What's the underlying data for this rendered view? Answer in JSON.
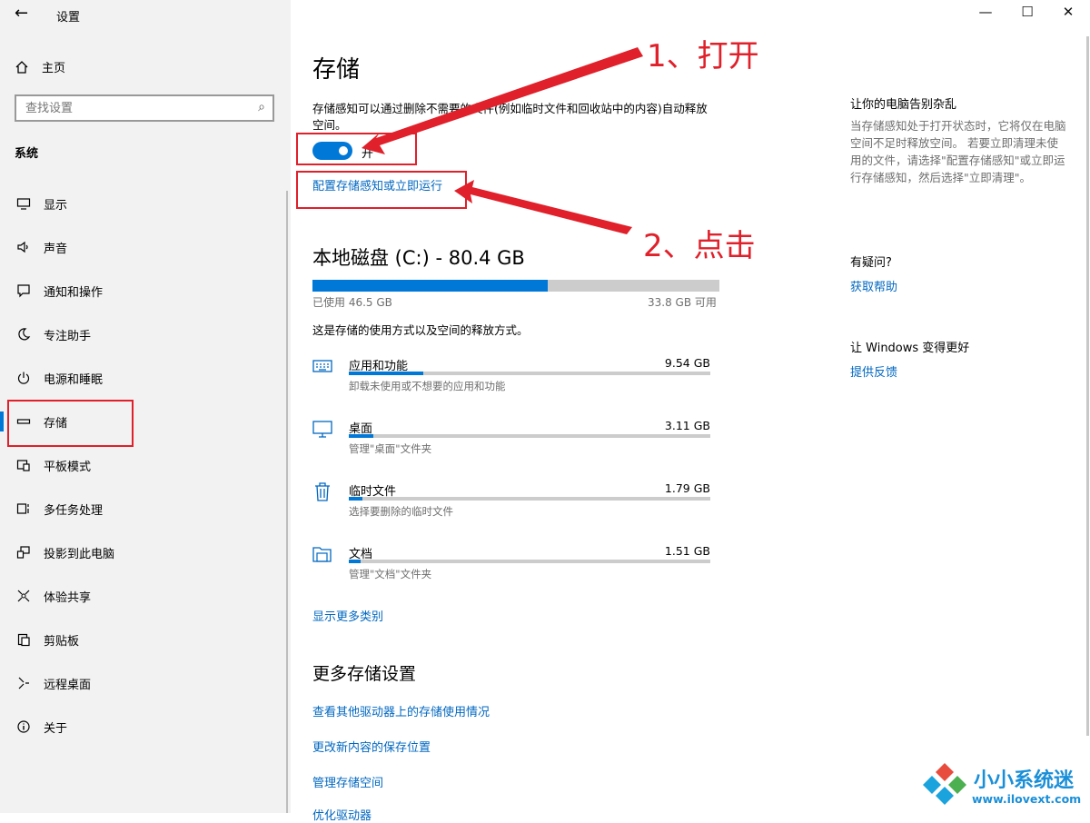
{
  "window": {
    "title": "设置",
    "controls": {
      "minimize": "—",
      "maximize": "☐",
      "close": "✕"
    }
  },
  "sidebar": {
    "home": "主页",
    "search_placeholder": "查找设置",
    "section_label": "系统",
    "items": [
      {
        "label": "显示",
        "icon": "monitor-icon"
      },
      {
        "label": "声音",
        "icon": "speaker-icon"
      },
      {
        "label": "通知和操作",
        "icon": "message-icon"
      },
      {
        "label": "专注助手",
        "icon": "moon-icon"
      },
      {
        "label": "电源和睡眠",
        "icon": "power-icon"
      },
      {
        "label": "存储",
        "icon": "storage-icon",
        "active": true
      },
      {
        "label": "平板模式",
        "icon": "tablet-icon"
      },
      {
        "label": "多任务处理",
        "icon": "multitask-icon"
      },
      {
        "label": "投影到此电脑",
        "icon": "project-icon"
      },
      {
        "label": "体验共享",
        "icon": "share-icon"
      },
      {
        "label": "剪贴板",
        "icon": "clipboard-icon"
      },
      {
        "label": "远程桌面",
        "icon": "remote-icon"
      },
      {
        "label": "关于",
        "icon": "info-icon"
      }
    ]
  },
  "main": {
    "title": "存储",
    "description": "存储感知可以通过删除不需要的文件(例如临时文件和回收站中的内容)自动释放空间。",
    "toggle_label": "开",
    "toggle_on": true,
    "configure_link": "配置存储感知或立即运行",
    "disk": {
      "title": "本地磁盘 (C:) - 80.4 GB",
      "used": "已使用 46.5 GB",
      "free": "33.8 GB 可用",
      "used_fraction": 0.578
    },
    "usage_desc": "这是存储的使用方式以及空间的释放方式。",
    "categories": [
      {
        "name": "应用和功能",
        "size": "9.54 GB",
        "desc": "卸载未使用或不想要的应用和功能",
        "fraction": 0.205,
        "icon": "keyboard-icon"
      },
      {
        "name": "桌面",
        "size": "3.11 GB",
        "desc": "管理\"桌面\"文件夹",
        "fraction": 0.067,
        "icon": "desktop-icon"
      },
      {
        "name": "临时文件",
        "size": "1.79 GB",
        "desc": "选择要删除的临时文件",
        "fraction": 0.038,
        "icon": "trash-icon"
      },
      {
        "name": "文档",
        "size": "1.51 GB",
        "desc": "管理\"文档\"文件夹",
        "fraction": 0.032,
        "icon": "folder-icon"
      }
    ],
    "show_more": "显示更多类别",
    "more_settings_title": "更多存储设置",
    "more_links": [
      "查看其他驱动器上的存储使用情况",
      "更改新内容的保存位置",
      "管理存储空间",
      "优化驱动器"
    ]
  },
  "right": {
    "heading1": "让你的电脑告别杂乱",
    "text1": "当存储感知处于打开状态时，它将仅在电脑空间不足时释放空间。 若要立即清理未使用的文件，请选择\"配置存储感知\"或立即运行存储感知，然后选择\"立即清理\"。",
    "heading2": "有疑问?",
    "link2": "获取帮助",
    "heading3": "让 Windows 变得更好",
    "link3": "提供反馈"
  },
  "annotations": {
    "step1": "1、打开",
    "step2": "2、点击",
    "color": "#e0202a"
  },
  "watermark": {
    "text": "小小系统迷",
    "url": "www.ilovext.com"
  }
}
